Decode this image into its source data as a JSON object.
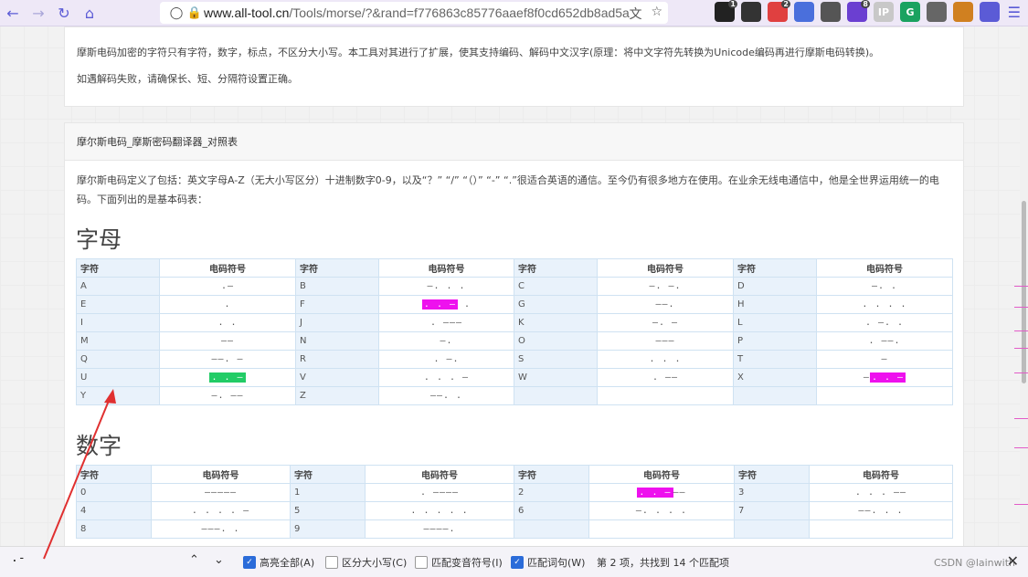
{
  "browser": {
    "url_host": "www.all-tool.cn",
    "url_rest": "/Tools/morse/?&rand=f776863c85776aaef8f0cd652db8ad5a",
    "extensions": [
      {
        "name": "ext-1",
        "color": "#222222",
        "badge": "1"
      },
      {
        "name": "ext-2",
        "color": "#333333",
        "badge": ""
      },
      {
        "name": "ext-3",
        "color": "#e04040",
        "badge": "2"
      },
      {
        "name": "ext-4",
        "color": "#4a6fdc",
        "badge": ""
      },
      {
        "name": "ext-5",
        "color": "#555555",
        "badge": ""
      },
      {
        "name": "ext-6",
        "color": "#6b3fd1",
        "badge": "8"
      },
      {
        "name": "ext-7",
        "color": "#c8c8c8",
        "badge": ""
      },
      {
        "name": "ext-8",
        "color": "#1aa260",
        "badge": ""
      },
      {
        "name": "ext-9",
        "color": "#666666",
        "badge": ""
      },
      {
        "name": "ext-10",
        "color": "#d08020",
        "badge": ""
      },
      {
        "name": "ext-11",
        "color": "#5b5bd6",
        "badge": ""
      }
    ],
    "ext_texts": [
      "",
      "",
      "",
      "",
      "",
      "",
      "IP",
      "G",
      "",
      "",
      ""
    ]
  },
  "card1": {
    "line0": "",
    "p1": "摩斯电码加密的字符只有字符，数字，标点，不区分大小写。本工具对其进行了扩展，使其支持编码、解码中文汉字(原理：将中文字符先转换为Unicode编码再进行摩斯电码转换)。",
    "p2": "如遇解码失败，请确保长、短、分隔符设置正确。"
  },
  "card2": {
    "heading": "摩尔斯电码_摩斯密码翻译器_对照表",
    "intro": "摩尔斯电码定义了包括：英文字母A-Z（无大小写区分）十进制数字0-9，以及“？” “/” “（）” “-” “.”很适合英语的通信。至今仍有很多地方在使用。在业余无线电通信中，他是全世界运用统一的电码。下面列出的是基本码表：",
    "letters_title": "字母",
    "numbers_title": "数字",
    "col_char": "字符",
    "col_code": "电码符号",
    "letters": [
      [
        [
          "A",
          ".–"
        ],
        [
          "B",
          "–. . ."
        ],
        [
          "C",
          "–. –."
        ],
        [
          "D",
          "–. ."
        ]
      ],
      [
        [
          "E",
          "."
        ],
        [
          "F",
          ". . – ."
        ],
        [
          "G",
          "––."
        ],
        [
          "H",
          ". . . ."
        ]
      ],
      [
        [
          "I",
          ". ."
        ],
        [
          "J",
          ". –––"
        ],
        [
          "K",
          "–. –"
        ],
        [
          "L",
          ". –. ."
        ]
      ],
      [
        [
          "M",
          "––"
        ],
        [
          "N",
          "–."
        ],
        [
          "O",
          "–––"
        ],
        [
          "P",
          ". ––."
        ]
      ],
      [
        [
          "Q",
          "––. –"
        ],
        [
          "R",
          ". –."
        ],
        [
          "S",
          ". . ."
        ],
        [
          "T",
          "–"
        ]
      ],
      [
        [
          "U",
          ". . –"
        ],
        [
          "V",
          ". . . –"
        ],
        [
          "W",
          ". ––"
        ],
        [
          "X",
          "–. . –"
        ]
      ],
      [
        [
          "Y",
          "–. ––"
        ],
        [
          "Z",
          "––. ."
        ],
        [
          "",
          ""
        ],
        [
          "",
          ""
        ]
      ]
    ],
    "numbers": [
      [
        [
          "0",
          "–––––"
        ],
        [
          "1",
          ". ––––"
        ],
        [
          "2",
          ". . –––"
        ],
        [
          "3",
          ". . . ––"
        ]
      ],
      [
        [
          "4",
          ". . . . –"
        ],
        [
          "5",
          ". . . . ."
        ],
        [
          "6",
          "–. . . ."
        ],
        [
          "7",
          "––. . ."
        ]
      ],
      [
        [
          "8",
          "–––. ."
        ],
        [
          "9",
          "––––."
        ],
        [
          "",
          ""
        ],
        [
          "",
          ""
        ]
      ]
    ]
  },
  "findbar": {
    "query": ".-",
    "highlight_all": "高亮全部(A)",
    "match_case": "区分大小写(C)",
    "match_diacritics": "匹配变音符号(I)",
    "whole_words": "匹配词句(W)",
    "status": "第 2 项，共找到 14 个匹配项",
    "watermark": "CSDN @lainwith"
  },
  "colors": {
    "accent": "#5b5bd6",
    "highlight_current": "#22cc66",
    "highlight_match": "#ee11ee",
    "annotation_arrow": "#e03030"
  }
}
